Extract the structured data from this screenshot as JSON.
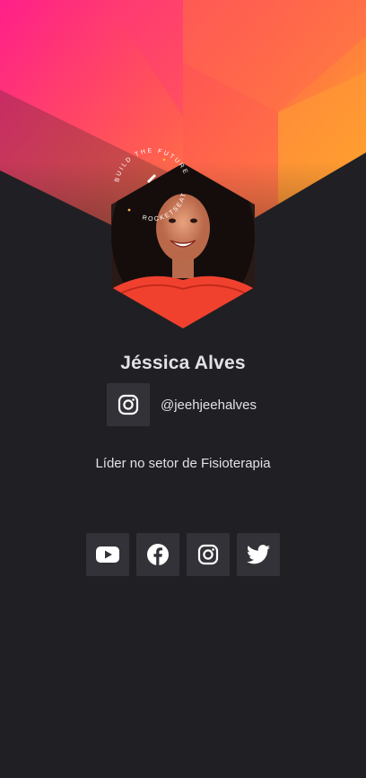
{
  "profile": {
    "name": "Jéssica Alves",
    "handle": "@jeehjeehalves",
    "bio": "Líder no setor de Fisioterapia",
    "avatar_alt": "profile photo"
  },
  "badge": {
    "arc_text": "BUILD THE FUTURE",
    "arc_text_2": "ROCKETSEAT"
  },
  "handle_icon": "instagram-icon",
  "social_links": [
    {
      "icon": "youtube-icon",
      "label": "YouTube"
    },
    {
      "icon": "facebook-icon",
      "label": "Facebook"
    },
    {
      "icon": "instagram-icon",
      "label": "Instagram"
    },
    {
      "icon": "twitter-icon",
      "label": "Twitter"
    }
  ],
  "colors": {
    "background": "#202024",
    "surface": "#323238",
    "text": "#e1e1e6",
    "accent_pink": "#ff1f8a",
    "accent_orange": "#ff9a2e"
  }
}
